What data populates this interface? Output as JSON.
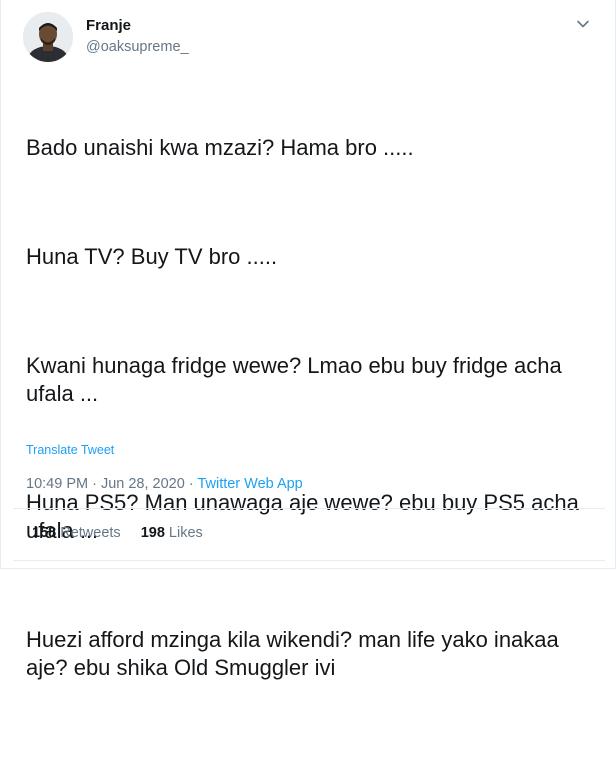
{
  "user": {
    "display_name": "Franje",
    "handle": "@oaksupreme_"
  },
  "tweet": {
    "paragraphs": [
      "Bado unaishi kwa mzazi? Hama bro .....",
      "Huna TV? Buy TV bro .....",
      "Kwani hunaga fridge wewe? Lmao ebu buy fridge acha ufala ...",
      "Huna PS5? Man unawaga aje wewe? ebu buy PS5 acha ufala ...",
      "Huezi afford mzinga kila wikendi? man life yako inakaa aje? ebu shika Old Smuggler ivi"
    ],
    "translate_label": "Translate Tweet",
    "timestamp": "10:49 PM · Jun 28, 2020 · ",
    "source_app": "Twitter Web App"
  },
  "stats": {
    "retweets_count": "158",
    "retweets_label": "Retweets",
    "likes_count": "198",
    "likes_label": "Likes"
  },
  "icons": {
    "menu": "chevron-down-icon"
  },
  "colors": {
    "accent": "#1da1f2",
    "secondary_text": "#657786",
    "primary_text": "#14171a",
    "border": "#e6ecf0"
  }
}
